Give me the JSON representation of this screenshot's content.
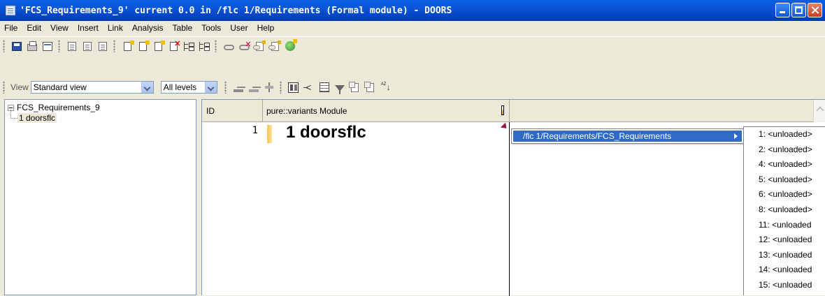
{
  "window": {
    "title": "'FCS_Requirements_9' current 0.0 in /flc 1/Requirements (Formal module) - DOORS"
  },
  "menu": [
    "File",
    "Edit",
    "View",
    "Insert",
    "Link",
    "Analysis",
    "Table",
    "Tools",
    "User",
    "Help"
  ],
  "toolbar_view": {
    "view_label": "View",
    "view_value": "Standard view",
    "levels_value": "All levels"
  },
  "tree": {
    "root": "FCS_Requirements_9",
    "child": "1 doorsflc"
  },
  "grid": {
    "columns": [
      "ID",
      "pure::variants Module"
    ],
    "rows": [
      {
        "id": "1",
        "text": "1 doorsflc"
      }
    ]
  },
  "context_menu": {
    "item": "/flc 1/Requirements/FCS_Requirements"
  },
  "submenu": {
    "items": [
      "1: <unloaded>",
      "2: <unloaded>",
      "4: <unloaded>",
      "5: <unloaded>",
      "6: <unloaded>",
      "8: <unloaded>",
      "11: <unloaded",
      "12: <unloaded",
      "13: <unloaded",
      "14: <unloaded",
      "15: <unloaded"
    ]
  },
  "colors": {
    "title_bar": "#0a56d7",
    "menu_highlight": "#316ac5",
    "selection_bar": "#f5c540"
  }
}
